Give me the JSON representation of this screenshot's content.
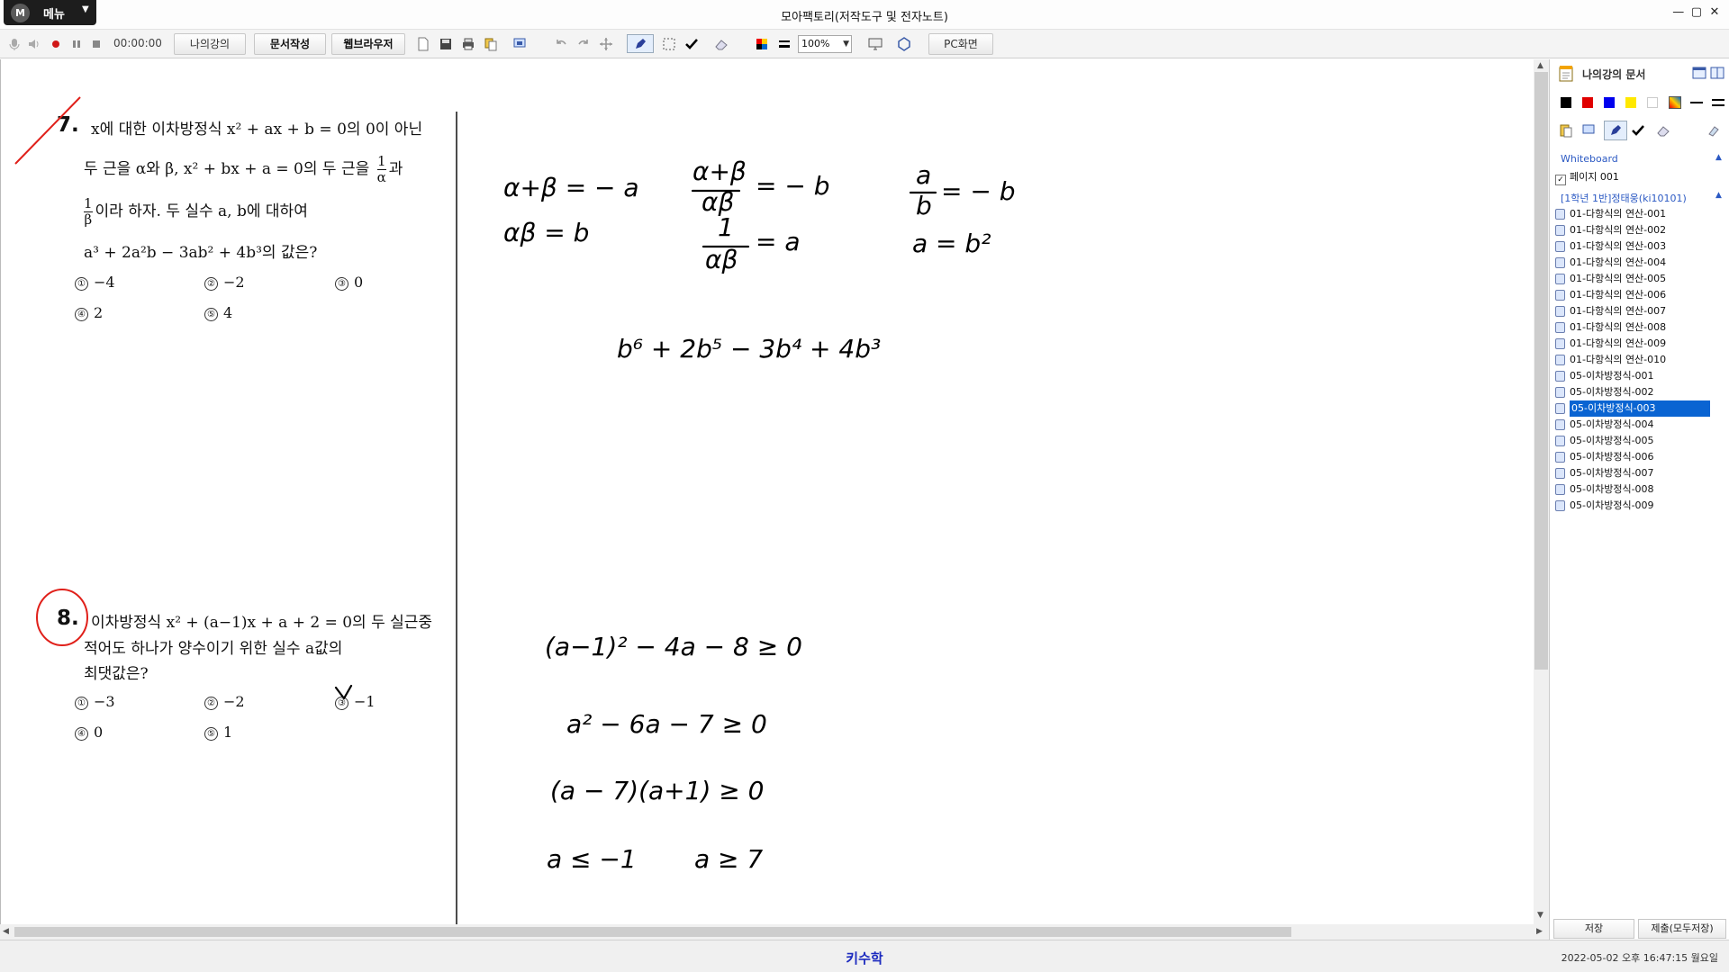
{
  "titlebar": {
    "menu_logo": "M",
    "menu_label": "메뉴",
    "title": "모아팩토리(저작도구 및 전자노트)",
    "min": "—",
    "max": "▢",
    "close": "✕"
  },
  "toolbar": {
    "time": "00:00:00",
    "tab_my_lecture": "나의강의",
    "tab_doc_write": "문서작성",
    "tab_web_browser": "웹브라우저",
    "zoom": "100%",
    "pc_screen": "PC화면"
  },
  "problem7": {
    "number": "7.",
    "line1": "x에 대한 이차방정식 x² + ax + b = 0의 0이 아닌",
    "line2a": "두 근을 α와 β, x² + bx + a = 0의 두 근을",
    "frac1_num": "1",
    "frac1_den": "α",
    "line2b": "과",
    "frac2_num": "1",
    "frac2_den": "β",
    "line3": "이라 하자. 두 실수 a, b에 대하여",
    "line4": "a³ + 2a²b − 3ab² + 4b³의 값은?",
    "options": [
      {
        "n": "①",
        "v": "−4"
      },
      {
        "n": "②",
        "v": "−2"
      },
      {
        "n": "③",
        "v": "0"
      },
      {
        "n": "④",
        "v": "2"
      },
      {
        "n": "⑤",
        "v": "4"
      }
    ]
  },
  "problem8": {
    "number": "8.",
    "line1": "이차방정식 x² + (a−1)x + a + 2 = 0의 두 실근중",
    "line2": "적어도 하나가 양수이기 위한 실수 a값의",
    "line3": "최댓값은?",
    "options": [
      {
        "n": "①",
        "v": "−3"
      },
      {
        "n": "②",
        "v": "−2"
      },
      {
        "n": "③",
        "v": "−1"
      },
      {
        "n": "④",
        "v": "0"
      },
      {
        "n": "⑤",
        "v": "1"
      }
    ]
  },
  "handwriting": {
    "h1": "α+β = − a",
    "h2": "αβ = b",
    "h3": "α+β",
    "h4": "αβ",
    "h5": "= − b",
    "h6": "1",
    "h7": "αβ",
    "h8": "= a",
    "h9": "a",
    "h10": "b",
    "h11": "= − b",
    "h12": "a = b²",
    "h13": "b⁶ + 2b⁵ − 3b⁴ + 4b³",
    "h14": "(a−1)² − 4a − 8 ≥ 0",
    "h15": "a² − 6a − 7 ≥ 0",
    "h16": "(a − 7)(a+1) ≥ 0",
    "h17": "a ≤ −1",
    "h18": "a ≥ 7"
  },
  "side": {
    "title": "나의강의 문서",
    "whiteboard": "Whiteboard",
    "page": "페이지 001",
    "group": "[1학년 1반]정태웅(ki10101)",
    "docs": [
      "01-다항식의 연산-001",
      "01-다항식의 연산-002",
      "01-다항식의 연산-003",
      "01-다항식의 연산-004",
      "01-다항식의 연산-005",
      "01-다항식의 연산-006",
      "01-다항식의 연산-007",
      "01-다항식의 연산-008",
      "01-다항식의 연산-009",
      "01-다항식의 연산-010",
      "05-이차방정식-001",
      "05-이차방정식-002",
      "05-이차방정식-003",
      "05-이차방정식-004",
      "05-이차방정식-005",
      "05-이차방정식-006",
      "05-이차방정식-007",
      "05-이차방정식-008",
      "05-이차방정식-009"
    ],
    "selected_index": 12,
    "save": "저장",
    "submit": "제출(모두저장)"
  },
  "status": {
    "center": "키수학",
    "datetime": "2022-05-02 오후 16:47:15 월요일"
  },
  "colors": {
    "palette": [
      "#000000",
      "#e00000",
      "#0000ee",
      "#ffe800",
      "#ffffff"
    ],
    "selected_doc": "#0a64d2",
    "status_text": "#1d2bbf",
    "red_mark": "#e0201a"
  }
}
